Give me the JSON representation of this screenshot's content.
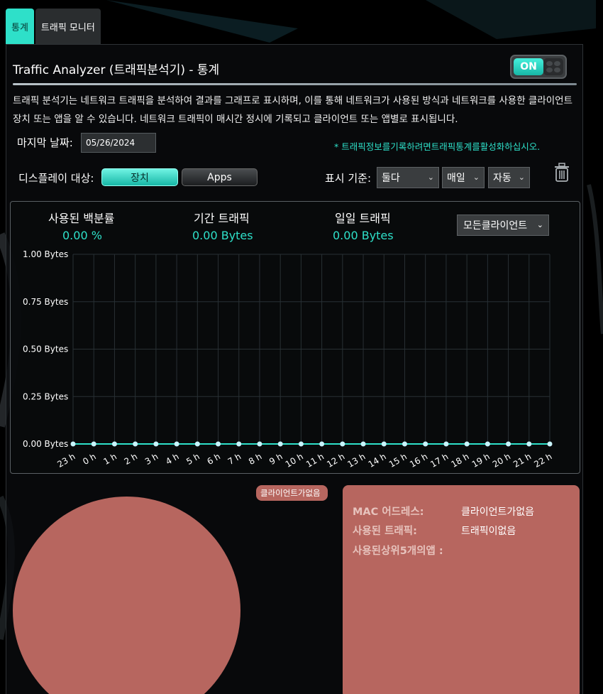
{
  "tabs": [
    {
      "label": "통계"
    },
    {
      "label": "트래픽 모니터"
    }
  ],
  "header": {
    "title": "Traffic Analyzer (트래픽분석기) - 통계",
    "toggle_label": "ON"
  },
  "description": "트래픽 분석기는 네트워크 트래픽을 분석하여 결과를 그래프로 표시하며, 이를 통해 네트워크가 사용된 방식과 네트워크를 사용한 클라이언트 장치 또는 앱을 알 수 있습니다. 네트워크 트래픽이 매시간 정시에 기록되고 클라이언트 또는 앱별로 표시됩니다.",
  "filters": {
    "last_date_label": "마지막 날짜:",
    "last_date_value": "05/26/2024",
    "notice": "* 트래픽정보를기록하려면트래픽통계를활성화하십시오.",
    "display_label": "디스플레이 대상:",
    "display_options": [
      "장치",
      "Apps"
    ],
    "basis_label": "표시 기준:",
    "direction_select": "둘다",
    "period_select": "매일",
    "refresh_select": "자동"
  },
  "stats": {
    "used_percent_label": "사용된 백분률",
    "used_percent_value": "0.00 %",
    "period_traffic_label": "기간 트래픽",
    "period_traffic_value": "0.00 Bytes",
    "daily_traffic_label": "일일 트래픽",
    "daily_traffic_value": "0.00 Bytes",
    "client_select": "모든클라이언트"
  },
  "chart_data": {
    "type": "line",
    "categories": [
      "23 h",
      "0 h",
      "1 h",
      "2 h",
      "3 h",
      "4 h",
      "5 h",
      "6 h",
      "7 h",
      "8 h",
      "9 h",
      "10 h",
      "11 h",
      "12 h",
      "13 h",
      "14 h",
      "15 h",
      "16 h",
      "17 h",
      "18 h",
      "19 h",
      "20 h",
      "21 h",
      "22 h"
    ],
    "values": [
      0,
      0,
      0,
      0,
      0,
      0,
      0,
      0,
      0,
      0,
      0,
      0,
      0,
      0,
      0,
      0,
      0,
      0,
      0,
      0,
      0,
      0,
      0,
      0
    ],
    "y_ticks": [
      "0.00 Bytes",
      "0.25 Bytes",
      "0.50 Bytes",
      "0.75 Bytes",
      "1.00 Bytes"
    ],
    "ylim": [
      0,
      1
    ],
    "grid": true,
    "line_color": "#2ee0c9",
    "point_color": "#c9f4ff"
  },
  "client_info": {
    "tag": "클라이언트가없음",
    "mac_label": "MAC 어드레스:",
    "mac_value": "클라이언트가없음",
    "traffic_label": "사용된 트래픽:",
    "traffic_value": "트래픽이없음",
    "top_apps_label": "사용된상위5개의앱 :"
  },
  "colors": {
    "accent": "#2ee0c9",
    "card": "#b7665f"
  }
}
